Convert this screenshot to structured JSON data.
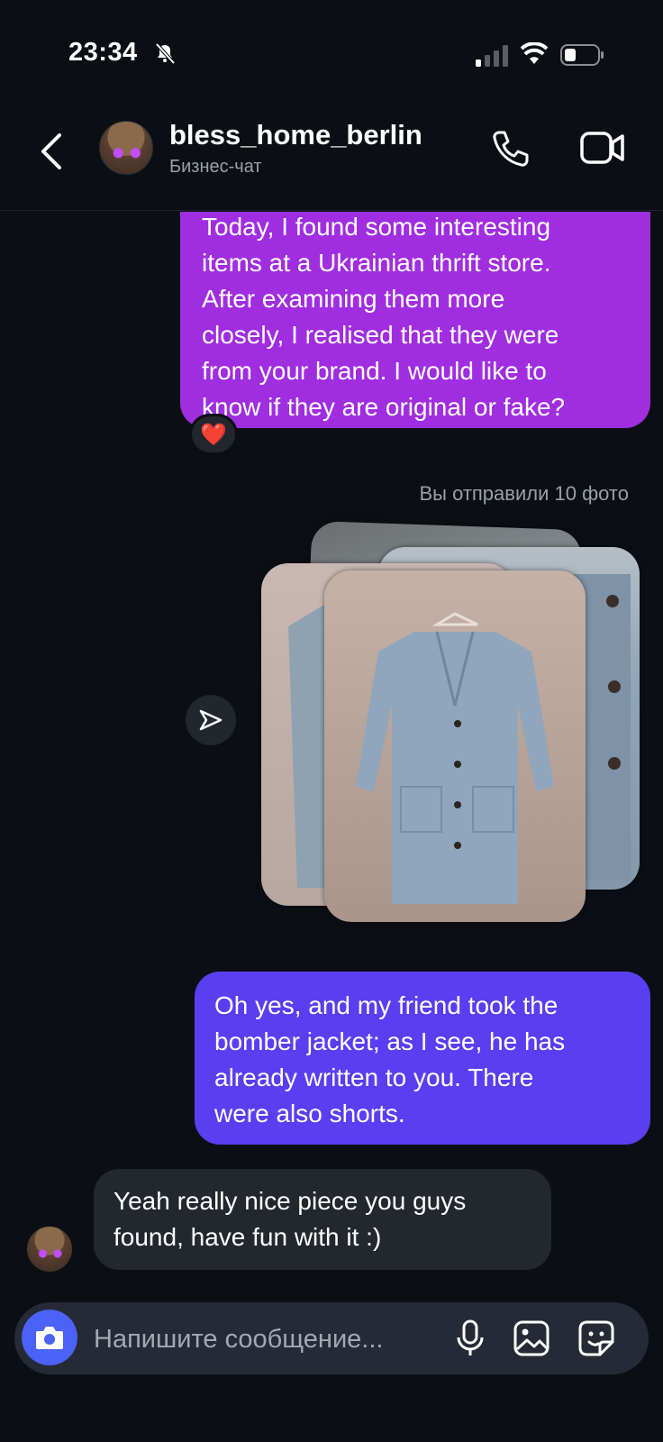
{
  "status_bar": {
    "time": "23:34"
  },
  "header": {
    "username": "bless_home_berlin",
    "subtitle": "Бизнес-чат"
  },
  "messages": {
    "sent_1": "Today, I found some interesting\nitems at a Ukrainian thrift store.\nAfter examining them more\nclosely, I realised that they were\nfrom your brand. I would like to\nknow if they are original or fake?",
    "reaction": "❤️",
    "sent_photos_label": "Вы отправили 10 фото",
    "sent_2": "Oh yes, and my friend took the\nbomber jacket; as I see, he has\nalready written to you. There\nwere also shorts.",
    "received_1": "Yeah really nice piece you guys\nfound, have fun with it :)"
  },
  "composer": {
    "placeholder": "Напишите сообщение..."
  },
  "colors": {
    "background": "#0b0f14",
    "bubble_purple": "#a02ee0",
    "bubble_violet": "#5b3ef2",
    "bubble_received": "#23272e",
    "camera_button": "#4a62f5"
  }
}
